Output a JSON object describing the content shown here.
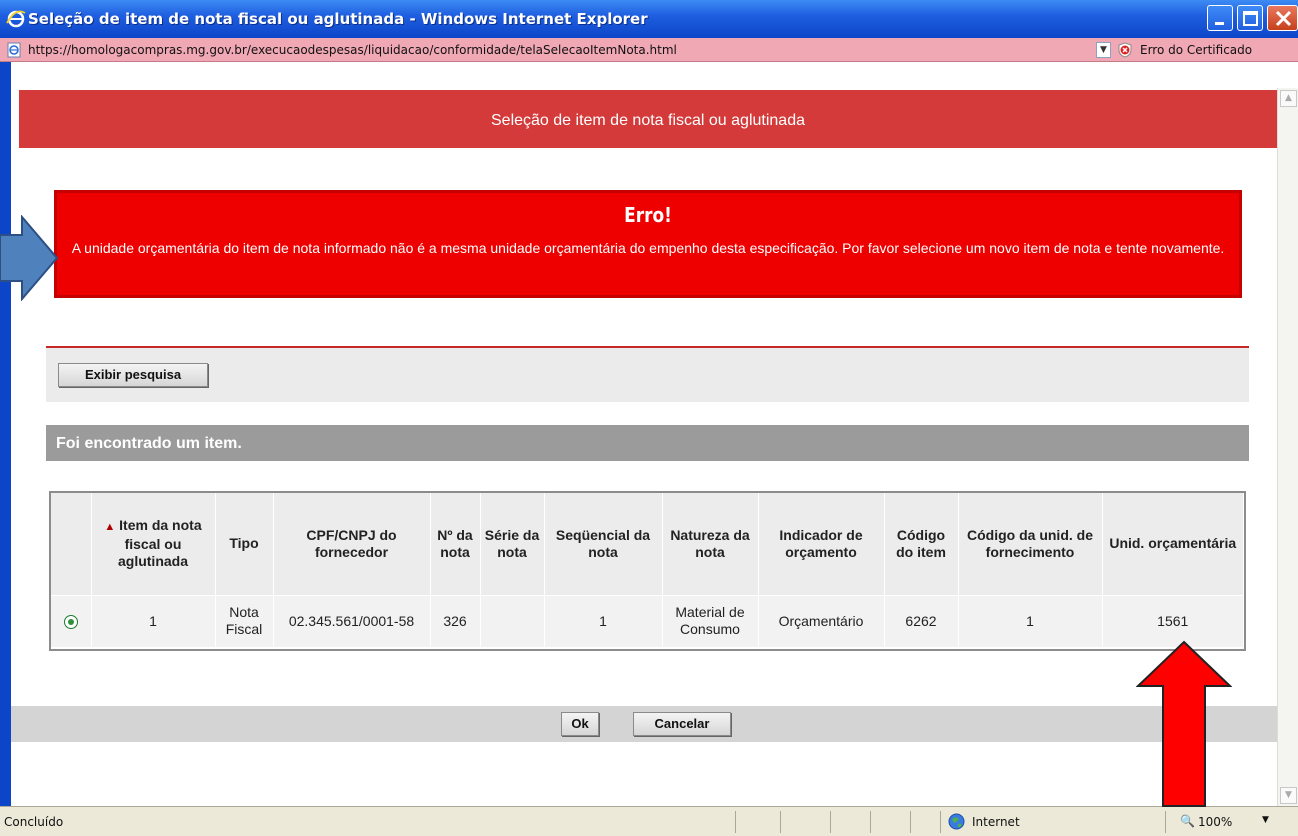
{
  "window": {
    "title": "Seleção de item de nota fiscal ou aglutinada - Windows Internet Explorer",
    "url": "https://homologacompras.mg.gov.br/execucaodespesas/liquidacao/conformidade/telaSelecaoItemNota.html",
    "cert_error": "Erro do Certificado"
  },
  "page": {
    "header": "Seleção de item de nota fiscal ou aglutinada",
    "error_title": "Erro!",
    "error_message": "A unidade orçamentária do item de nota informado não é a mesma unidade orçamentária do empenho desta especificação. Por favor selecione um novo item de nota e tente novamente.",
    "show_search_label": "Exibir pesquisa",
    "result_text": "Foi encontrado um item.",
    "ok_label": "Ok",
    "cancel_label": "Cancelar"
  },
  "table": {
    "columns": [
      "Item da nota fiscal ou aglutinada",
      "Tipo",
      "CPF/CNPJ do fornecedor",
      "Nº da nota",
      "Série da nota",
      "Seqüencial da nota",
      "Natureza da nota",
      "Indicador de orçamento",
      "Código do item",
      "Código da unid. de fornecimento",
      "Unid. orçamentária"
    ],
    "rows": [
      {
        "item": "1",
        "tipo": "Nota Fiscal",
        "cpf_cnpj": "02.345.561/0001-58",
        "numero": "326",
        "serie": "",
        "sequencial": "1",
        "natureza": "Material de Consumo",
        "indicador": "Orçamentário",
        "codigo_item": "6262",
        "codigo_unid": "1",
        "unid_orcamentaria": "1561",
        "selected": true
      }
    ]
  },
  "status": {
    "text": "Concluído",
    "zone": "Internet",
    "zoom": "100%"
  },
  "colors": {
    "header_band": "#d43a3a",
    "error_box": "#ee0000",
    "result_band": "#9b9b9b",
    "annotation_blue": "#4f81bd",
    "annotation_red": "#ff0000"
  },
  "icons": [
    "ie-logo-icon",
    "minimize-icon",
    "maximize-icon",
    "close-icon",
    "page-icon",
    "cert-error-icon",
    "internet-zone-icon",
    "zoom-icon"
  ]
}
